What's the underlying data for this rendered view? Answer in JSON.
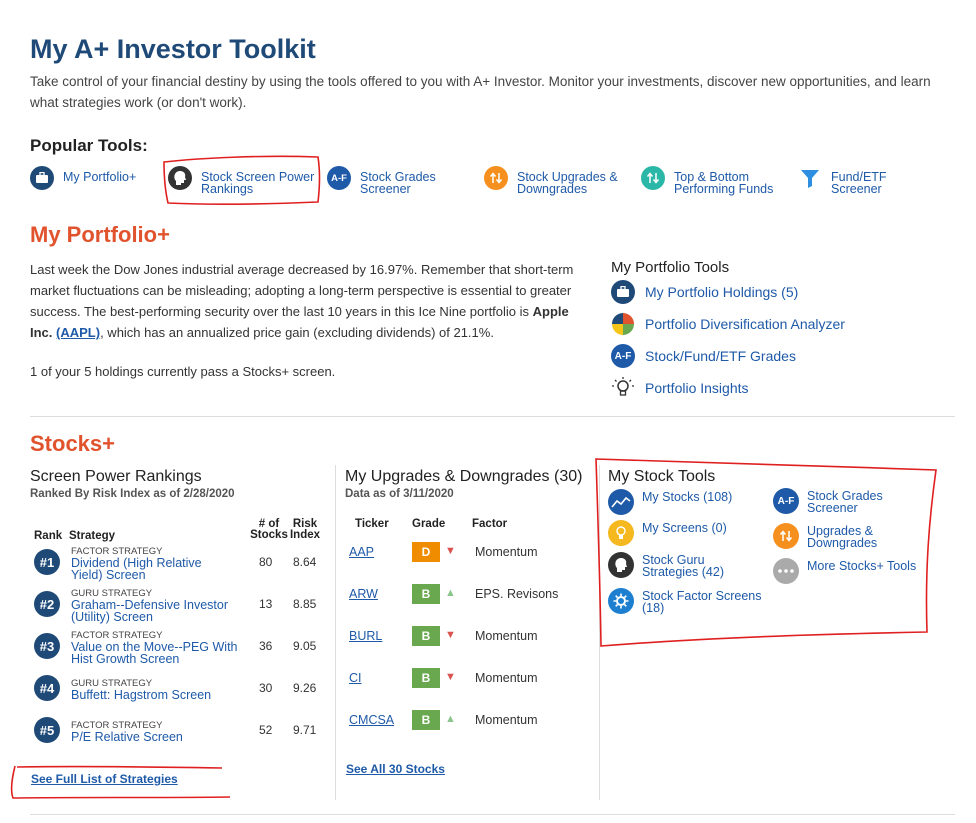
{
  "header": {
    "title": "My A+ Investor Toolkit",
    "intro": "Take control of your financial destiny by using the tools offered to you with A+ Investor. Monitor your investments, discover new opportunities, and learn what strategies work (or don't work)."
  },
  "popular_tools": {
    "label": "Popular Tools:",
    "items": [
      {
        "line1": "My Portfolio+",
        "line2": "",
        "icon": "briefcase-icon"
      },
      {
        "line1": "Stock Screen Power",
        "line2": "Rankings",
        "icon": "guru-head-icon"
      },
      {
        "line1": "Stock Grades",
        "line2": "Screener",
        "icon": "grades-af-icon",
        "badge": "A-F"
      },
      {
        "line1": "Stock Upgrades &",
        "line2": "Downgrades",
        "icon": "updown-arrows-icon"
      },
      {
        "line1": "Top & Bottom",
        "line2": "Performing Funds",
        "icon": "updown-arrows-teal-icon"
      },
      {
        "line1": "Fund/ETF",
        "line2": "Screener",
        "icon": "funnel-icon"
      }
    ]
  },
  "portfolio": {
    "title": "My Portfolio+",
    "text_before": "Last week the Dow Jones industrial average decreased by 16.97%. Remember that short-term market fluctuations can be misleading; adopting a long-term perspective is essential to greater success. The best-performing security over the last 10 years in this Ice Nine portfolio is ",
    "company": "Apple Inc.",
    "ticker": "(AAPL)",
    "text_after": ", which has an annualized price gain (excluding dividends) of 21.1%.",
    "holdings_note": "1 of your 5 holdings currently pass a Stocks+ screen.",
    "tools_title": "My Portfolio Tools",
    "tools": [
      {
        "label": "My Portfolio Holdings (5)",
        "icon": "briefcase-icon"
      },
      {
        "label": "Portfolio Diversification Analyzer",
        "icon": "pie-chart-icon"
      },
      {
        "label": "Stock/Fund/ETF Grades",
        "icon": "grades-af-icon",
        "badge": "A-F"
      },
      {
        "label": "Portfolio Insights",
        "icon": "lightbulb-icon"
      }
    ]
  },
  "stocks": {
    "title": "Stocks+",
    "rankings": {
      "title": "Screen Power Rankings",
      "subtitle": "Ranked By Risk Index as of 2/28/2020",
      "headers": {
        "rank": "Rank",
        "strategy": "Strategy",
        "stocks_1": "# of",
        "stocks_2": "Stocks",
        "risk_1": "Risk",
        "risk_2": "Index"
      },
      "rows": [
        {
          "rank": "#1",
          "type": "FACTOR STRATEGY",
          "name1": "Dividend (High Relative",
          "name2": "Yield) Screen",
          "stocks": "80",
          "risk": "8.64"
        },
        {
          "rank": "#2",
          "type": "GURU STRATEGY",
          "name1": "Graham--Defensive Investor",
          "name2": "(Utility) Screen",
          "stocks": "13",
          "risk": "8.85"
        },
        {
          "rank": "#3",
          "type": "FACTOR STRATEGY",
          "name1": "Value on the Move--PEG With",
          "name2": "Hist Growth Screen",
          "stocks": "36",
          "risk": "9.05"
        },
        {
          "rank": "#4",
          "type": "GURU STRATEGY",
          "name1": "Buffett: Hagstrom Screen",
          "name2": "",
          "stocks": "30",
          "risk": "9.26"
        },
        {
          "rank": "#5",
          "type": "FACTOR STRATEGY",
          "name1": "P/E Relative Screen",
          "name2": "",
          "stocks": "52",
          "risk": "9.71"
        }
      ],
      "see_all": "See Full List of Strategies"
    },
    "upgrades": {
      "title": "My Upgrades & Downgrades (30)",
      "subtitle": "Data as of 3/11/2020",
      "headers": {
        "ticker": "Ticker",
        "grade": "Grade",
        "factor": "Factor"
      },
      "rows": [
        {
          "ticker": "AAP",
          "grade": "D",
          "grade_color": "#f08c00",
          "direction": "down",
          "factor": "Momentum"
        },
        {
          "ticker": "ARW",
          "grade": "B",
          "grade_color": "#6aa84f",
          "direction": "up",
          "factor": "EPS. Revisons"
        },
        {
          "ticker": "BURL",
          "grade": "B",
          "grade_color": "#6aa84f",
          "direction": "down",
          "factor": "Momentum"
        },
        {
          "ticker": "CI",
          "grade": "B",
          "grade_color": "#6aa84f",
          "direction": "down",
          "factor": "Momentum"
        },
        {
          "ticker": "CMCSA",
          "grade": "B",
          "grade_color": "#6aa84f",
          "direction": "up",
          "factor": "Momentum"
        }
      ],
      "see_all": "See All 30 Stocks"
    },
    "stock_tools": {
      "title": "My Stock Tools",
      "left": [
        {
          "line1": "My Stocks (108)",
          "line2": "",
          "icon": "stock-chart-icon"
        },
        {
          "line1": "My Screens (0)",
          "line2": "",
          "icon": "lightbulb-icon"
        },
        {
          "line1": "Stock Guru",
          "line2": "Strategies (42)",
          "icon": "guru-head-icon"
        },
        {
          "line1": "Stock Factor Screens",
          "line2": "(18)",
          "icon": "gear-bulb-icon"
        }
      ],
      "right": [
        {
          "line1": "Stock Grades",
          "line2": "Screener",
          "icon": "grades-af-icon",
          "badge": "A-F"
        },
        {
          "line1": "Upgrades &",
          "line2": "Downgrades",
          "icon": "updown-arrows-icon"
        },
        {
          "line1": "More Stocks+ Tools",
          "line2": "",
          "icon": "more-dots-icon"
        }
      ]
    }
  },
  "colors": {
    "title_blue": "#1f4a78",
    "accent_orange": "#e0532d",
    "link_blue": "#1e5aa8",
    "annotation_red": "#e02020"
  }
}
